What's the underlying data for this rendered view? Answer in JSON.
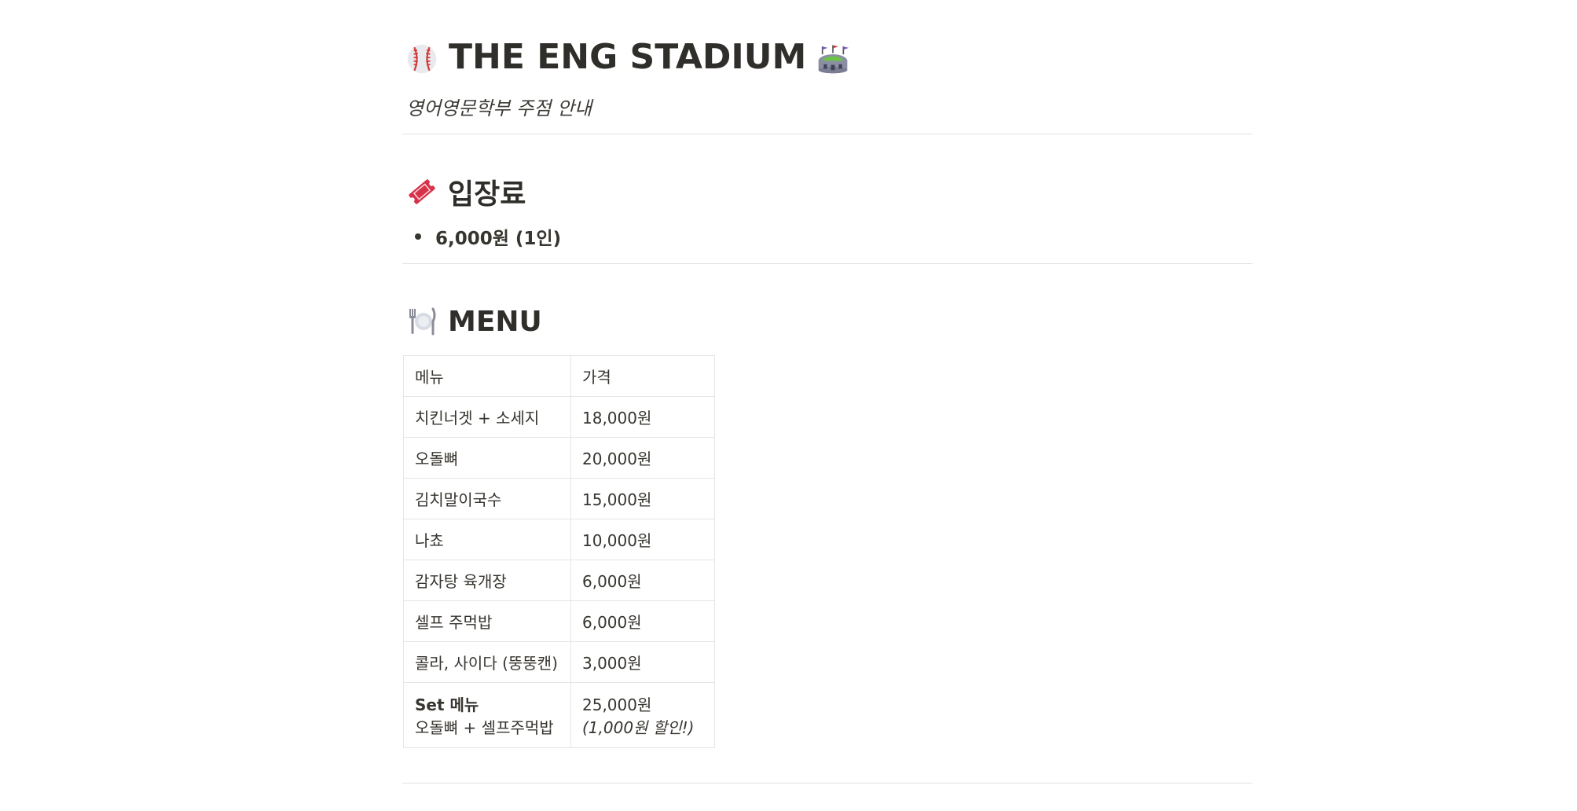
{
  "page": {
    "title": "THE ENG STADIUM",
    "title_icons": [
      "baseball-icon",
      "stadium-icon"
    ],
    "subtitle": "영어영문학부 주점 안내"
  },
  "admission": {
    "heading": "입장료",
    "icon": "ticket-icon",
    "items": [
      "6,000원 (1인)"
    ]
  },
  "menu": {
    "heading": "MENU",
    "icon": "fork-knife-plate-icon",
    "columns": [
      "메뉴",
      "가격"
    ],
    "rows": [
      {
        "name": "치킨너겟 + 소세지",
        "price": "18,000원"
      },
      {
        "name": "오돌뼈",
        "price": "20,000원"
      },
      {
        "name": "김치말이국수",
        "price": "15,000원"
      },
      {
        "name": "나쵸",
        "price": "10,000원"
      },
      {
        "name": "감자탕 육개장",
        "price": "6,000원"
      },
      {
        "name": "셀프 주먹밥",
        "price": "6,000원"
      },
      {
        "name": "콜라, 사이다 (뚱뚱캔)",
        "price": "3,000원"
      }
    ],
    "set": {
      "title": "Set 메뉴",
      "contents": "오돌뼈 + 셀프주먹밥",
      "price": "25,000원",
      "discount": "(1,000원 할인!)"
    }
  },
  "colors": {
    "text": "#37352f",
    "divider": "#e3e2df",
    "table_border": "#e6e5e2",
    "background": "#ffffff"
  }
}
